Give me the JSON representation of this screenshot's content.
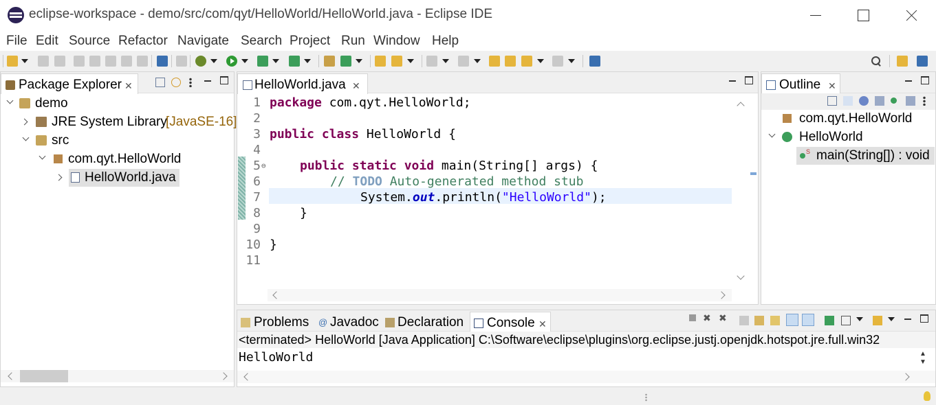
{
  "window": {
    "title": "eclipse-workspace - demo/src/com/qyt/HelloWorld/HelloWorld.java - Eclipse IDE"
  },
  "menu": [
    "File",
    "Edit",
    "Source",
    "Refactor",
    "Navigate",
    "Search",
    "Project",
    "Run",
    "Window",
    "Help"
  ],
  "package_explorer": {
    "tab_label": "Package Explorer",
    "tree": {
      "project": "demo",
      "jre_label": "JRE System Library",
      "jre_version": "[JavaSE-16]",
      "src": "src",
      "package": "com.qyt.HelloWorld",
      "file": "HelloWorld.java"
    }
  },
  "editor": {
    "tab_label": "HelloWorld.java",
    "line_numbers": [
      "1",
      "2",
      "3",
      "4",
      "5",
      "6",
      "7",
      "8",
      "9",
      "10",
      "11"
    ],
    "code": {
      "l1_kw": "package",
      "l1_rest": " com.qyt.HelloWorld;",
      "l3_kw": "public class",
      "l3_rest": " HelloWorld {",
      "l5_kw": "public static void",
      "l5_rest": " main(String[] args) {",
      "l6_comment": "// ",
      "l6_todo": "TODO",
      "l6_rest": " Auto-generated method stub",
      "l7_obj": "System.",
      "l7_field": "out",
      "l7_call": ".println(",
      "l7_str": "\"HelloWorld\"",
      "l7_end": ");",
      "l8": "}",
      "l10": "}"
    }
  },
  "outline": {
    "tab_label": "Outline",
    "package": "com.qyt.HelloWorld",
    "class": "HelloWorld",
    "method": "main(String[]) : void"
  },
  "bottom": {
    "tabs": [
      "Problems",
      "Javadoc",
      "Declaration",
      "Console"
    ],
    "console_status": "<terminated> HelloWorld [Java Application] C:\\Software\\eclipse\\plugins\\org.eclipse.justj.openjdk.hotspot.jre.full.win32",
    "console_output": "HelloWorld"
  }
}
